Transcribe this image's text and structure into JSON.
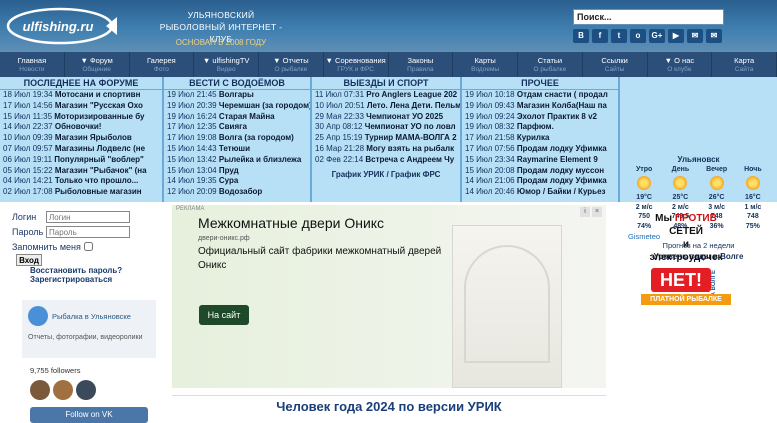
{
  "header": {
    "logo_text": "ulfishing.ru",
    "club_title": "УЛЬЯНОВСКИЙ РЫБОЛОВНЫЙ ИНТЕРНЕТ - КЛУБ",
    "since": "ОСНОВАН В 2008 ГОДУ",
    "search_placeholder": "Поиск...",
    "social": [
      "В",
      "f",
      "t",
      "o",
      "G+",
      "▶",
      "✉",
      "✉"
    ]
  },
  "nav": [
    {
      "label": "Главная",
      "sub": "Новости"
    },
    {
      "label": "▼ Форум",
      "sub": "Общение"
    },
    {
      "label": "Галерея",
      "sub": "Фото"
    },
    {
      "label": "▼ ulfishingTV",
      "sub": "Видео"
    },
    {
      "label": "▼ Отчеты",
      "sub": "О рыбалке"
    },
    {
      "label": "▼ Соревнования",
      "sub": "ГРУК и ФРС"
    },
    {
      "label": "Законы",
      "sub": "Правила"
    },
    {
      "label": "Карты",
      "sub": "Водоемы"
    },
    {
      "label": "Статьи",
      "sub": "О рыбалке"
    },
    {
      "label": "Ссылки",
      "sub": "Сайты"
    },
    {
      "label": "▼ О нас",
      "sub": "О клубе"
    },
    {
      "label": "Карта",
      "sub": "Сайта"
    }
  ],
  "news": {
    "forum": {
      "title": "ПОСЛЕДНЕЕ НА ФОРУМЕ",
      "items": [
        {
          "date": "18 Июл 19:34",
          "text": "Мотосани и спортивн"
        },
        {
          "date": "17 Июл 14:56",
          "text": "Магазин \"Русская Охо"
        },
        {
          "date": "15 Июл 11:35",
          "text": "Моторизированные бу"
        },
        {
          "date": "14 Июл 22:37",
          "text": "Обновочки!"
        },
        {
          "date": "10 Июл 09:39",
          "text": "Магазин Ярыболов"
        },
        {
          "date": "07 Июл 09:57",
          "text": "Магазины Лодвелс (не"
        },
        {
          "date": "06 Июл 19:11",
          "text": "Популярный \"воблер\""
        },
        {
          "date": "05 Июл 15:22",
          "text": "Магазин \"Рыбачок\" (на"
        },
        {
          "date": "04 Июл 14:21",
          "text": "Только что прошло..."
        },
        {
          "date": "02 Июл 17:08",
          "text": "Рыболовные магазин"
        }
      ]
    },
    "waters": {
      "title": "ВЕСТИ С ВОДОЁМОВ",
      "items": [
        {
          "date": "19 Июл 21:45",
          "text": "Волгары"
        },
        {
          "date": "19 Июл 20:39",
          "text": "Черемшан (за городом)"
        },
        {
          "date": "19 Июл 16:24",
          "text": "Старая Майна"
        },
        {
          "date": "17 Июл 12:35",
          "text": "Свияга"
        },
        {
          "date": "17 Июл 19:08",
          "text": "Волга (за городом)"
        },
        {
          "date": "15 Июл 14:43",
          "text": "Тетюши"
        },
        {
          "date": "15 Июл 13:42",
          "text": "Рылейка и близлежа"
        },
        {
          "date": "15 Июл 13:04",
          "text": "Пруд"
        },
        {
          "date": "14 Июл 19:35",
          "text": "Сура"
        },
        {
          "date": "12 Июл 20:09",
          "text": "Водозабор"
        }
      ]
    },
    "trips": {
      "title": "ВЫЕЗДЫ И СПОРТ",
      "items": [
        {
          "date": "11 Июл 07:31",
          "text": "Pro Anglers League 202"
        },
        {
          "date": "10 Июл 20:51",
          "text": "Лето. Лена Дети. Пельм"
        },
        {
          "date": "29 Мая 22:33",
          "text": "Чемпионат УО 2025"
        },
        {
          "date": "30 Апр 08:12",
          "text": "Чемпионат УО по ловл"
        },
        {
          "date": "25 Апр 15:19",
          "text": "Турнир МАМА-ВОЛГА 2"
        },
        {
          "date": "16 Мар 21:28",
          "text": "Могу взять на рыбалк"
        },
        {
          "date": "02 Фев 22:14",
          "text": "Встреча с Андреем Чу"
        }
      ],
      "links": "График УРИК / График ФРС"
    },
    "other": {
      "title": "ПРОЧЕЕ",
      "items": [
        {
          "date": "19 Июл 10:18",
          "text": "Отдам снасти ( продал"
        },
        {
          "date": "19 Июл 09:43",
          "text": "Магазин Колба(Наш па"
        },
        {
          "date": "19 Июл 09:24",
          "text": "Эхолот Практик 8 v2"
        },
        {
          "date": "19 Июл 08:32",
          "text": "Парфюм."
        },
        {
          "date": "17 Июл 21:58",
          "text": "Курилка"
        },
        {
          "date": "17 Июл 07:56",
          "text": "Продам лодку Уфимка"
        },
        {
          "date": "15 Июл 23:34",
          "text": "Raymarine Element 9"
        },
        {
          "date": "15 Июл 20:08",
          "text": "Продам лодку муссон"
        },
        {
          "date": "14 Июл 21:06",
          "text": "Продам лодку Уфимка"
        },
        {
          "date": "14 Июл 20:46",
          "text": "Юмор / Байки / Курьез"
        }
      ]
    }
  },
  "weather": {
    "city": "Ульяновск",
    "cols": [
      {
        "head": "Утро",
        "temp": "19°C",
        "wind": "2 м/с",
        "pressure": "750",
        "humid": "74%"
      },
      {
        "head": "День",
        "temp": "25°C",
        "wind": "2 м/с",
        "pressure": "749.5",
        "humid": "48%"
      },
      {
        "head": "Вечер",
        "temp": "26°C",
        "wind": "3 м/с",
        "pressure": "748",
        "humid": "36%"
      },
      {
        "head": "Ночь",
        "temp": "16°C",
        "wind": "1 м/с",
        "pressure": "748",
        "humid": "75%"
      }
    ],
    "brand": "Gismeteo",
    "forecast": "Прогноз на 2 недели",
    "level": "Уровень воды в Волге"
  },
  "login": {
    "login_label": "Логин",
    "login_placeholder": "Логин",
    "pass_label": "Пароль",
    "pass_placeholder": "Пароль",
    "remember": "Запомнить меня",
    "button": "Вход",
    "forgot": "Восстановить пароль?",
    "register": "Зарегистрироваться"
  },
  "vk": {
    "name": "Рыбалка в Ульяновске",
    "desc": "Отчеты, фотографии, видеоролики",
    "followers": "9,755 followers",
    "follow": "Follow on VK"
  },
  "ad": {
    "label": "РЕКЛАМА",
    "title": "Межкомнатные двери Оникс",
    "domain": "двери-оникс.рф",
    "text": "Официальный сайт фабрики межкомнатный дверей Оникс",
    "button": "На сайт"
  },
  "person_year": "Человек года 2024 по версии УРИК",
  "against": {
    "line1": "Мы",
    "red": "ПРОТИВ",
    "line2": "СЕТЕЙ",
    "line3": "и",
    "line4": "электроудочек"
  },
  "net_badge": {
    "net": "НЕТ!",
    "label": "ПЛАТНОЙ РЫБАЛКЕ",
    "side": "НА ВОЛГЕ"
  }
}
